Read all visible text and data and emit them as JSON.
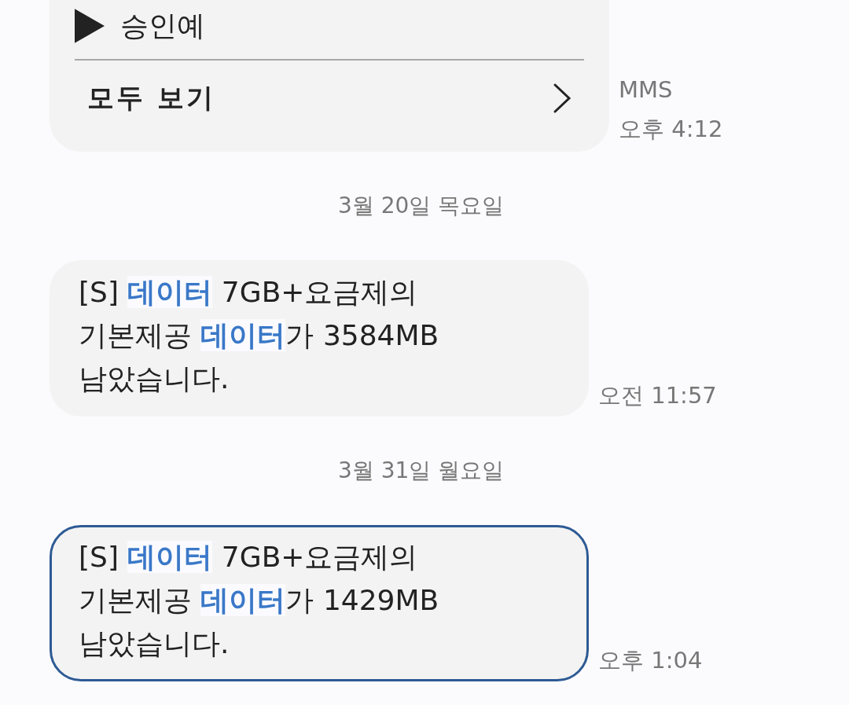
{
  "card": {
    "items": [
      {
        "kind": "play",
        "label": "승인예"
      },
      {
        "kind": "link",
        "label": "모두 보기"
      }
    ],
    "type_label": "MMS",
    "time": "오후 4:12"
  },
  "thread": [
    {
      "kind": "date",
      "text": "3월 20일 목요일"
    },
    {
      "kind": "message",
      "selected": false,
      "time": "오전 11:57",
      "lines": [
        [
          {
            "text": "[S] ",
            "highlighted": false
          },
          {
            "text": "데이터",
            "highlighted": true
          },
          {
            "text": " 7GB+요금제의",
            "highlighted": false
          }
        ],
        [
          {
            "text": "기본제공 ",
            "highlighted": false
          },
          {
            "text": "데이터",
            "highlighted": true
          },
          {
            "text": "가 3584MB",
            "highlighted": false
          }
        ],
        [
          {
            "text": "남았습니다.",
            "highlighted": false
          }
        ]
      ]
    },
    {
      "kind": "date",
      "text": "3월 31일 월요일"
    },
    {
      "kind": "message",
      "selected": true,
      "time": "오후 1:04",
      "lines": [
        [
          {
            "text": "[S] ",
            "highlighted": false
          },
          {
            "text": "데이터",
            "highlighted": true
          },
          {
            "text": " 7GB+요금제의",
            "highlighted": false
          }
        ],
        [
          {
            "text": "기본제공 ",
            "highlighted": false
          },
          {
            "text": "데이터",
            "highlighted": true
          },
          {
            "text": "가 1429MB",
            "highlighted": false
          }
        ],
        [
          {
            "text": "남았습니다.",
            "highlighted": false
          }
        ]
      ]
    }
  ]
}
